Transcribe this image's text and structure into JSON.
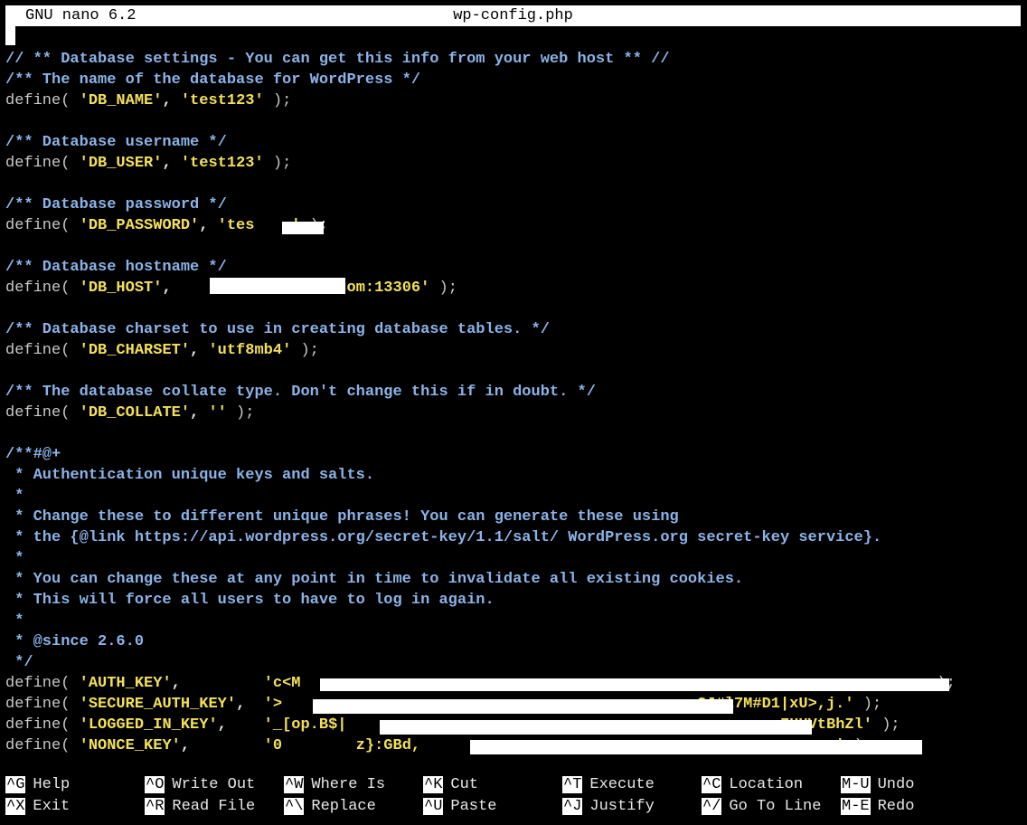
{
  "titlebar": {
    "app": "GNU nano 6.2",
    "file": "wp-config.php"
  },
  "lines": [
    {
      "i": "0",
      "segs": [
        {
          "c": "c",
          "t": "// ** Database settings - You can get this info from your web host ** //"
        }
      ]
    },
    {
      "i": "1",
      "segs": [
        {
          "c": "c",
          "t": "/** The name of the database for WordPress */"
        }
      ]
    },
    {
      "i": "2",
      "segs": [
        {
          "c": "d",
          "t": "define( "
        },
        {
          "c": "y",
          "t": "'DB_NAME'"
        },
        {
          "c": "w",
          "t": ", "
        },
        {
          "c": "y",
          "t": "'test123'"
        },
        {
          "c": "d",
          "t": " );"
        }
      ]
    },
    {
      "i": "4",
      "segs": [
        {
          "c": "c",
          "t": "/** Database username */"
        }
      ]
    },
    {
      "i": "5",
      "segs": [
        {
          "c": "d",
          "t": "define( "
        },
        {
          "c": "y",
          "t": "'DB_USER'"
        },
        {
          "c": "w",
          "t": ", "
        },
        {
          "c": "y",
          "t": "'test123'"
        },
        {
          "c": "d",
          "t": " );"
        }
      ]
    },
    {
      "i": "7",
      "segs": [
        {
          "c": "c",
          "t": "/** Database password */"
        }
      ]
    },
    {
      "i": "8",
      "segs": [
        {
          "c": "d",
          "t": "define( "
        },
        {
          "c": "y",
          "t": "'DB_PASSWORD'"
        },
        {
          "c": "w",
          "t": ", "
        },
        {
          "c": "y",
          "t": "'tes    '"
        },
        {
          "c": "d",
          "t": " );"
        }
      ]
    },
    {
      "i": "10",
      "segs": [
        {
          "c": "c",
          "t": "/** Database hostname */"
        }
      ]
    },
    {
      "i": "11",
      "segs": [
        {
          "c": "d",
          "t": "define( "
        },
        {
          "c": "y",
          "t": "'DB_HOST'"
        },
        {
          "c": "w",
          "t": ",                 "
        },
        {
          "c": "y",
          "t": ".com:13306'"
        },
        {
          "c": "d",
          "t": " );"
        }
      ]
    },
    {
      "i": "13",
      "segs": [
        {
          "c": "c",
          "t": "/** Database charset to use in creating database tables. */"
        }
      ]
    },
    {
      "i": "14",
      "segs": [
        {
          "c": "d",
          "t": "define( "
        },
        {
          "c": "y",
          "t": "'DB_CHARSET'"
        },
        {
          "c": "w",
          "t": ", "
        },
        {
          "c": "y",
          "t": "'utf8mb4'"
        },
        {
          "c": "d",
          "t": " );"
        }
      ]
    },
    {
      "i": "16",
      "segs": [
        {
          "c": "c",
          "t": "/** The database collate type. Don't change this if in doubt. */"
        }
      ]
    },
    {
      "i": "17",
      "segs": [
        {
          "c": "d",
          "t": "define( "
        },
        {
          "c": "y",
          "t": "'DB_COLLATE'"
        },
        {
          "c": "w",
          "t": ", "
        },
        {
          "c": "y",
          "t": "''"
        },
        {
          "c": "d",
          "t": " );"
        }
      ]
    },
    {
      "i": "19",
      "segs": [
        {
          "c": "c",
          "t": "/**#@+"
        }
      ]
    },
    {
      "i": "20",
      "segs": [
        {
          "c": "c",
          "t": " * Authentication unique keys and salts."
        }
      ]
    },
    {
      "i": "21",
      "segs": [
        {
          "c": "c",
          "t": " *"
        }
      ]
    },
    {
      "i": "22",
      "segs": [
        {
          "c": "c",
          "t": " * Change these to different unique phrases! You can generate these using"
        }
      ]
    },
    {
      "i": "23",
      "segs": [
        {
          "c": "c",
          "t": " * the {@link https://api.wordpress.org/secret-key/1.1/salt/ WordPress.org secret-key service}."
        }
      ]
    },
    {
      "i": "24",
      "segs": [
        {
          "c": "c",
          "t": " *"
        }
      ]
    },
    {
      "i": "25",
      "segs": [
        {
          "c": "c",
          "t": " * You can change these at any point in time to invalidate all existing cookies."
        }
      ]
    },
    {
      "i": "26",
      "segs": [
        {
          "c": "c",
          "t": " * This will force all users to have to log in again."
        }
      ]
    },
    {
      "i": "27",
      "segs": [
        {
          "c": "c",
          "t": " *"
        }
      ]
    },
    {
      "i": "28",
      "segs": [
        {
          "c": "c",
          "t": " * @since 2.6.0"
        }
      ]
    },
    {
      "i": "29",
      "segs": [
        {
          "c": "c",
          "t": " */"
        }
      ]
    },
    {
      "i": "30",
      "segs": [
        {
          "c": "d",
          "t": "define( "
        },
        {
          "c": "y",
          "t": "'AUTH_KEY'"
        },
        {
          "c": "w",
          "t": ",         "
        },
        {
          "c": "y",
          "t": "'c<M"
        },
        {
          "c": "w",
          "t": "                                                                    "
        },
        {
          "c": "d",
          "t": " );"
        }
      ]
    },
    {
      "i": "31",
      "segs": [
        {
          "c": "d",
          "t": "define( "
        },
        {
          "c": "y",
          "t": "'SECURE_AUTH_KEY'"
        },
        {
          "c": "w",
          "t": ",  "
        },
        {
          "c": "y",
          "t": "'>"
        },
        {
          "c": "w",
          "t": "                                            "
        },
        {
          "c": "y",
          "t": "a2J#l7M#D1|xU>,j.'"
        },
        {
          "c": "d",
          "t": " );"
        }
      ]
    },
    {
      "i": "32",
      "segs": [
        {
          "c": "d",
          "t": "define( "
        },
        {
          "c": "y",
          "t": "'LOGGED_IN_KEY'"
        },
        {
          "c": "w",
          "t": ",    "
        },
        {
          "c": "y",
          "t": "'_[op.B$|"
        },
        {
          "c": "w",
          "t": "                                               "
        },
        {
          "c": "y",
          "t": "ZHUVtBhZl'"
        },
        {
          "c": "d",
          "t": " );"
        }
      ]
    },
    {
      "i": "33",
      "segs": [
        {
          "c": "d",
          "t": "define( "
        },
        {
          "c": "y",
          "t": "'NONCE_KEY'"
        },
        {
          "c": "w",
          "t": ",        "
        },
        {
          "c": "y",
          "t": "'0        z}:GBd,"
        },
        {
          "c": "w",
          "t": "                                            "
        },
        {
          "c": "y",
          "t": ".'"
        },
        {
          "c": "d",
          "t": " );"
        }
      ]
    }
  ],
  "shortcuts": [
    {
      "key": "^G",
      "label": "Help"
    },
    {
      "key": "^O",
      "label": "Write Out"
    },
    {
      "key": "^W",
      "label": "Where Is"
    },
    {
      "key": "^K",
      "label": "Cut"
    },
    {
      "key": "^T",
      "label": "Execute"
    },
    {
      "key": "^C",
      "label": "Location"
    },
    {
      "key": "M-U",
      "label": "Undo"
    },
    {
      "key": "^X",
      "label": "Exit"
    },
    {
      "key": "^R",
      "label": "Read File"
    },
    {
      "key": "^\\",
      "label": "Replace"
    },
    {
      "key": "^U",
      "label": "Paste"
    },
    {
      "key": "^J",
      "label": "Justify"
    },
    {
      "key": "^/",
      "label": "Go To Line"
    },
    {
      "key": "M-E",
      "label": "Redo"
    }
  ],
  "colors": {
    "comment": "#8bb3e8",
    "string": "#f2e05a",
    "text": "#c9c9c9",
    "background": "#000000",
    "bar": "#ffffff"
  }
}
